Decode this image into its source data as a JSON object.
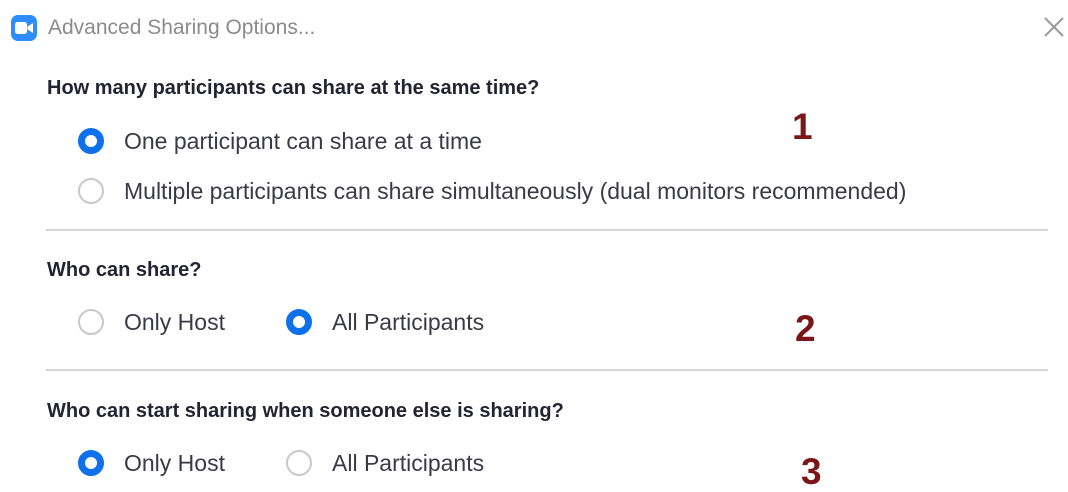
{
  "window": {
    "title": "Advanced Sharing Options...",
    "app_icon": "zoom-camera-icon",
    "close_icon": "close-icon"
  },
  "sections": [
    {
      "question": "How many participants can share at the same time?",
      "options": [
        {
          "label": "One participant can share at a time",
          "checked": true
        },
        {
          "label": "Multiple participants can share simultaneously (dual monitors recommended)",
          "checked": false
        }
      ],
      "annotation": "1"
    },
    {
      "question": "Who can share?",
      "options": [
        {
          "label": "Only Host",
          "checked": false
        },
        {
          "label": "All Participants",
          "checked": true
        }
      ],
      "annotation": "2"
    },
    {
      "question": "Who can start sharing when someone else is sharing?",
      "options": [
        {
          "label": "Only Host",
          "checked": true
        },
        {
          "label": "All Participants",
          "checked": false
        }
      ],
      "annotation": "3"
    }
  ],
  "colors": {
    "accent": "#0e71eb",
    "annotation": "#7a1518",
    "app_icon": "#2d8cff"
  }
}
